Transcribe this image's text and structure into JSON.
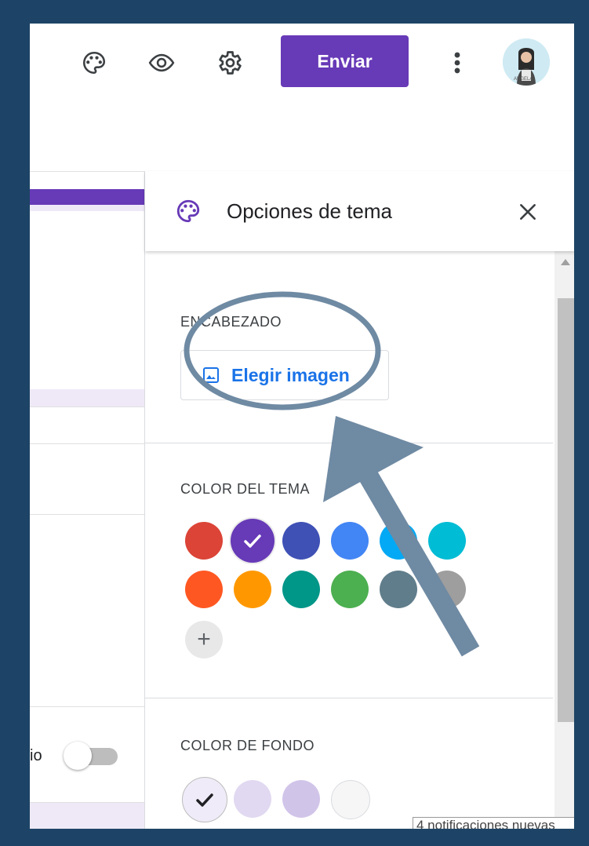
{
  "toolbar": {
    "palette_icon": "palette-icon",
    "preview_icon": "eye-icon",
    "settings_icon": "gear-icon",
    "send_label": "Enviar",
    "more_icon": "more-vert-icon",
    "avatar_caption": "ANGELA"
  },
  "form": {
    "partial_label": "io"
  },
  "theme_panel": {
    "title": "Opciones de tema",
    "close_icon": "close-icon",
    "header_section": {
      "label": "ENCABEZADO",
      "choose_image_label": "Elegir imagen",
      "image_icon": "image-icon"
    },
    "theme_color_section": {
      "label": "COLOR DEL TEMA",
      "selected": "#673ab7",
      "colors": [
        "#db4437",
        "#673ab7",
        "#3f51b5",
        "#4285f4",
        "#03a9f4",
        "#00bcd4",
        "#ff5722",
        "#ff9800",
        "#009688",
        "#4caf50",
        "#607d8b",
        "#9e9e9e"
      ],
      "add_label": "+"
    },
    "background_color_section": {
      "label": "COLOR DE FONDO",
      "selected": "#f0ebf8",
      "colors": [
        "#f0ebf8",
        "#e1d8f1",
        "#d1c4e9",
        "#f6f6f6"
      ]
    }
  },
  "notification": "4 notificaciones nuevas",
  "annotation": {
    "color": "#6f8aa3"
  }
}
